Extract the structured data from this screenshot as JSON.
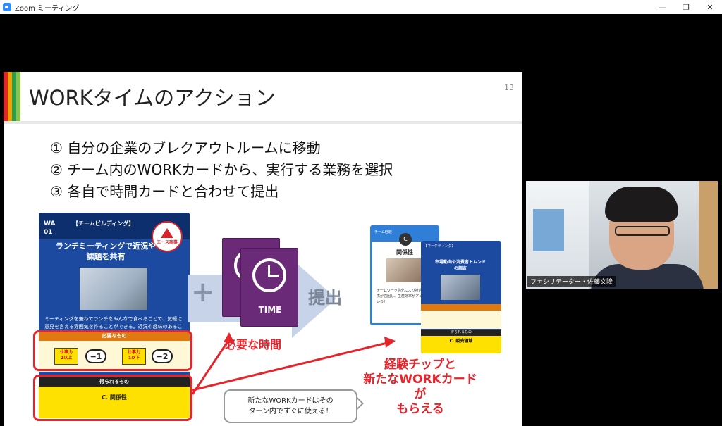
{
  "window": {
    "title": "Zoom ミーティング",
    "minimize": "—",
    "restore": "❐",
    "close": "✕"
  },
  "slide": {
    "title": "WORKタイムのアクション",
    "page_number": "13",
    "steps": [
      "① 自分の企業のブレクアウトルームに移動",
      "② チーム内のWORKカードから、実行する業務を選択",
      "③ 各自で時間カードと合わせて提出"
    ],
    "work_card": {
      "id_line1": "WA",
      "id_line2": "01",
      "category": "【チームビルディング】",
      "name": "ランチミーティングで近況や課題を共有",
      "badge": "エース商事",
      "description": "ミーティングを兼ねてランチをみんなで食べることで、気軽に意見を言える雰囲気を作ることができる。近況や趣味のあることを共有することで、自然とお互いの理解につながる。",
      "need_label": "必要なもの",
      "req1_tag": "仕事力",
      "req1_level": "2以上",
      "req1_value": "−1",
      "req2_tag": "仕事力",
      "req2_level": "1以下",
      "req2_value": "−2",
      "get_label": "得られるもの",
      "get_value": "C. 関係性"
    },
    "plus": "+",
    "submit": "提出",
    "time_card_label": "TIME",
    "time_caption": "必要な時間",
    "chip_card": {
      "header": "チーム経験",
      "letter": "C",
      "name": "関係性",
      "description": "チームワーク強化により社内での連携が強固し、生産効率がアップしている！"
    },
    "new_card": {
      "category": "【マーケティング】",
      "title": "市場動向や消費者トレンドの調査",
      "get_label": "得られるもの",
      "get_value": "C. 販売領域"
    },
    "exp_caption": [
      "経験チップと",
      "新たなWORKカードが",
      "もらえる"
    ],
    "bubble": [
      "新たなWORKカードはその",
      "ターン内ですぐに使える！"
    ]
  },
  "webcam": {
    "participant_label": "ファシリテーター・佐藤文隆"
  },
  "colors": {
    "accent_red": "#e5242b",
    "card_blue": "#1b4aa0",
    "time_purple": "#6b2a78",
    "zoom_blue": "#2d8cff"
  }
}
